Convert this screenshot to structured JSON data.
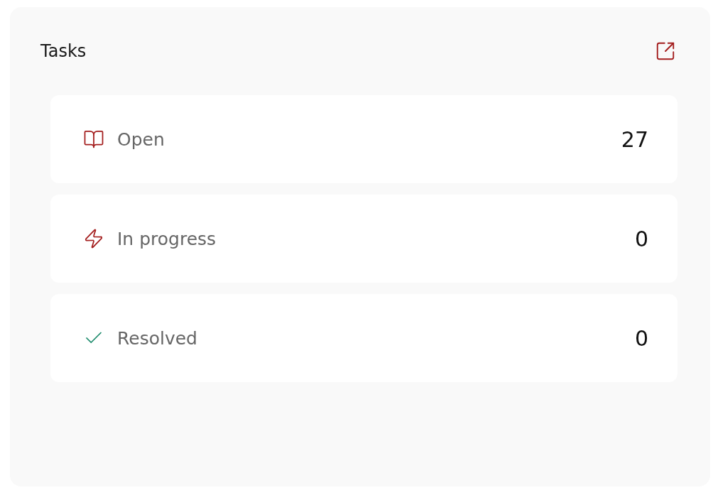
{
  "card": {
    "title": "Tasks"
  },
  "rows": [
    {
      "kind": "open",
      "label": "Open",
      "value": "27"
    },
    {
      "kind": "progress",
      "label": "In progress",
      "value": "0"
    },
    {
      "kind": "resolved",
      "label": "Resolved",
      "value": "0"
    }
  ]
}
